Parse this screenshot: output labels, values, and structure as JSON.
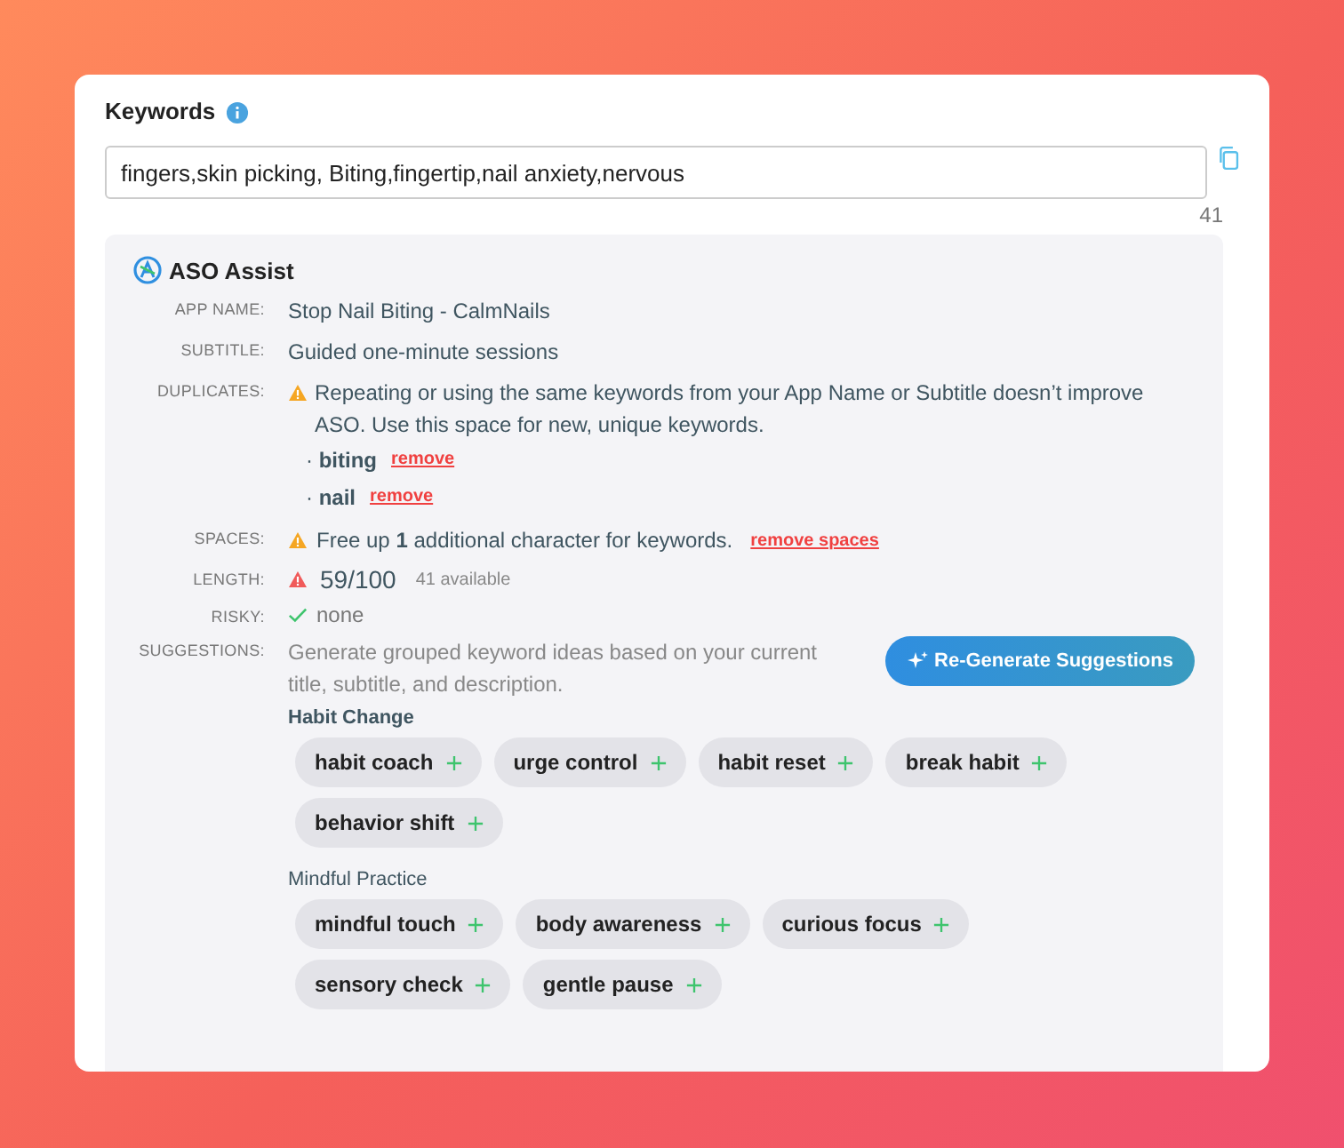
{
  "keywords": {
    "label": "Keywords",
    "value": "fingers,skin picking, Biting,fingertip,nail anxiety,nervous",
    "count": "41"
  },
  "assist": {
    "title": "ASO Assist",
    "app_name": {
      "label": "APP NAME:",
      "value": "Stop Nail Biting - CalmNails"
    },
    "subtitle": {
      "label": "SUBTITLE:",
      "value": "Guided one-minute sessions"
    },
    "duplicates": {
      "label": "DUPLICATES:",
      "message": "Repeating or using the same keywords from your App Name or Subtitle doesn’t improve ASO. Use this space for new, unique keywords.",
      "items": [
        {
          "bullet": "·",
          "word": "biting",
          "action": "remove"
        },
        {
          "bullet": "·",
          "word": "nail",
          "action": "remove"
        }
      ]
    },
    "spaces": {
      "label": "SPACES:",
      "message": "Free up **1** additional character for keywords.",
      "action": "remove spaces"
    },
    "length": {
      "label": "LENGTH:",
      "value": "59/100",
      "available": "41 available"
    },
    "risky": {
      "label": "RISKY:",
      "value": "none"
    },
    "suggestions": {
      "label": "SUGGESTIONS:",
      "description": "Generate grouped keyword ideas based on your current title, subtitle, and description.",
      "button": "Re-Generate Suggestions",
      "groups": [
        {
          "name": "Habit Change",
          "chips": [
            "habit coach",
            "urge control",
            "habit reset",
            "break habit",
            "behavior shift"
          ]
        },
        {
          "name": "Mindful Practice",
          "chips": [
            "mindful touch",
            "body awareness",
            "curious focus",
            "sensory check",
            "gentle pause"
          ]
        }
      ]
    }
  }
}
